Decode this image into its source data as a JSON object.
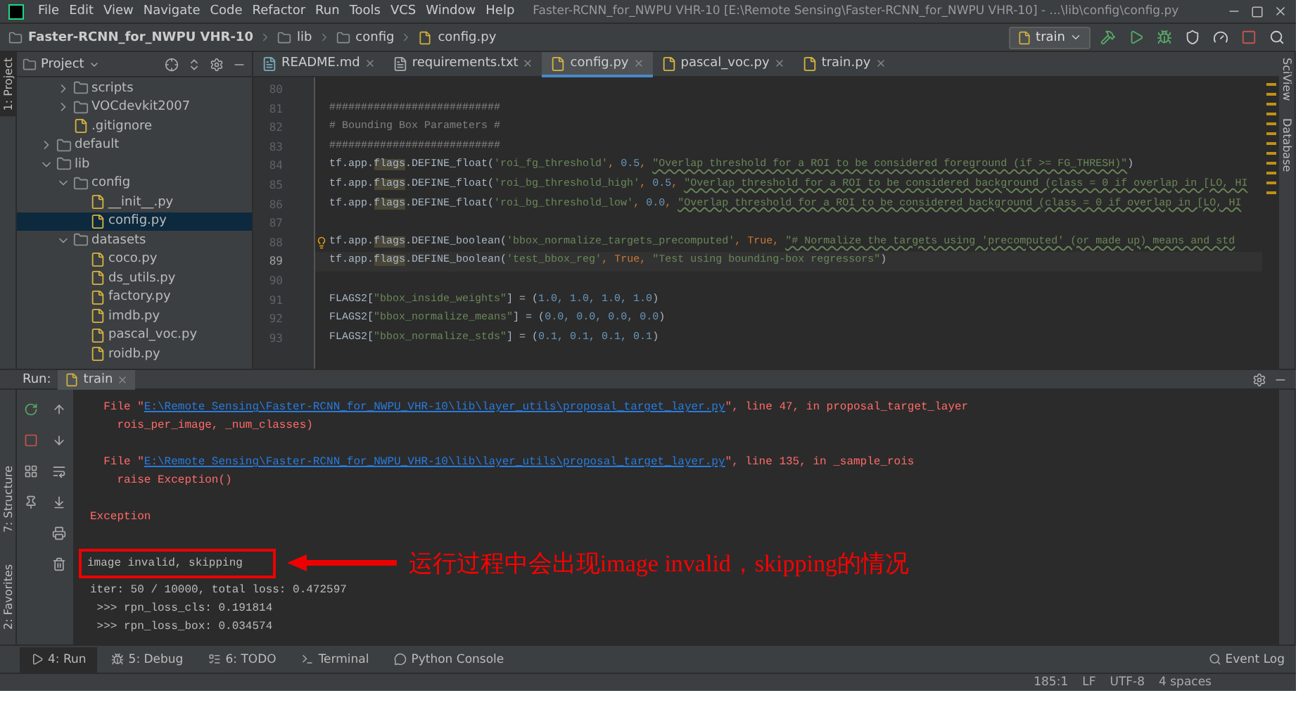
{
  "window": {
    "title": "Faster-RCNN_for_NWPU VHR-10 [E:\\Remote Sensing\\Faster-RCNN_for_NWPU VHR-10] - ...\\lib\\config\\config.py"
  },
  "menu": [
    "File",
    "Edit",
    "View",
    "Navigate",
    "Code",
    "Refactor",
    "Run",
    "Tools",
    "VCS",
    "Window",
    "Help"
  ],
  "breadcrumb": [
    {
      "kind": "project",
      "label": "Faster-RCNN_for_NWPU VHR-10"
    },
    {
      "kind": "folder",
      "label": "lib"
    },
    {
      "kind": "folder",
      "label": "config"
    },
    {
      "kind": "file",
      "label": "config.py"
    }
  ],
  "run_config": "train",
  "left_strip": [
    {
      "label": "1: Project",
      "selected": true
    },
    {
      "label": "7: Structure",
      "selected": false
    },
    {
      "label": "2: Favorites",
      "selected": false
    }
  ],
  "right_strip": [
    "SciView",
    "Database"
  ],
  "project_panel": {
    "title": "Project",
    "items_of_hidden_folder": [
      {
        "kind": "folder",
        "label": "scripts",
        "expanded": false,
        "selected": false
      },
      {
        "kind": "folder",
        "label": "VOCdevkit2007",
        "expanded": false,
        "selected": false
      },
      {
        "kind": "file",
        "label": ".gitignore",
        "selected": false
      }
    ],
    "tree": [
      {
        "kind": "folder",
        "label": "default",
        "expanded": false,
        "selected": false
      },
      {
        "kind": "folder",
        "label": "lib",
        "expanded": true,
        "selected": false,
        "children": [
          {
            "kind": "folder",
            "label": "config",
            "expanded": true,
            "selected": false,
            "children": [
              {
                "kind": "file",
                "label": "__init__.py",
                "selected": false
              },
              {
                "kind": "file",
                "label": "config.py",
                "selected": true
              }
            ]
          },
          {
            "kind": "folder",
            "label": "datasets",
            "expanded": true,
            "selected": false,
            "children": [
              {
                "kind": "file",
                "label": "coco.py",
                "selected": false
              },
              {
                "kind": "file",
                "label": "ds_utils.py",
                "selected": false
              },
              {
                "kind": "file",
                "label": "factory.py",
                "selected": false
              },
              {
                "kind": "file",
                "label": "imdb.py",
                "selected": false
              },
              {
                "kind": "file",
                "label": "pascal_voc.py",
                "selected": false
              },
              {
                "kind": "file",
                "label": "roidb.py",
                "selected": false
              }
            ]
          }
        ]
      }
    ]
  },
  "editor_tabs": [
    {
      "label": "README.md",
      "kind": "markdown",
      "selected": false
    },
    {
      "label": "requirements.txt",
      "kind": "text",
      "selected": false
    },
    {
      "label": "config.py",
      "kind": "python",
      "selected": true
    },
    {
      "label": "pascal_voc.py",
      "kind": "python",
      "selected": false
    },
    {
      "label": "train.py",
      "kind": "python",
      "selected": false
    }
  ],
  "code_lines": [
    {
      "number": "80",
      "current": false
    },
    {
      "number": "81",
      "current": false,
      "tokens": [
        {
          "kind": "comment",
          "text": "###########################"
        }
      ]
    },
    {
      "number": "82",
      "current": false,
      "tokens": [
        {
          "kind": "comment",
          "text": "# Bounding Box Parameters #"
        }
      ]
    },
    {
      "number": "83",
      "current": false,
      "tokens": [
        {
          "kind": "comment",
          "text": "###########################"
        }
      ]
    },
    {
      "number": "84",
      "current": false,
      "tokens": [
        {
          "kind": "plain",
          "text": "tf.app."
        },
        {
          "kind": "flag",
          "text": "flags"
        },
        {
          "kind": "plain",
          "text": ".DEFINE_float("
        },
        {
          "kind": "str",
          "text": "'roi_fg_threshold'"
        },
        {
          "kind": "kw",
          "text": ", "
        },
        {
          "kind": "num",
          "text": "0.5"
        },
        {
          "kind": "kw",
          "text": ", "
        },
        {
          "kind": "doc",
          "text": "\"Overlap threshold for a ROI to be considered foreground (if >= FG_THRESH)\""
        },
        {
          "kind": "plain",
          "text": ")"
        }
      ]
    },
    {
      "number": "85",
      "current": false,
      "tokens": [
        {
          "kind": "plain",
          "text": "tf.app."
        },
        {
          "kind": "flag",
          "text": "flags"
        },
        {
          "kind": "plain",
          "text": ".DEFINE_float("
        },
        {
          "kind": "str",
          "text": "'roi_bg_threshold_high'"
        },
        {
          "kind": "kw",
          "text": ", "
        },
        {
          "kind": "num",
          "text": "0.5"
        },
        {
          "kind": "kw",
          "text": ", "
        },
        {
          "kind": "doc",
          "text": "\"Overlap threshold for a ROI to be considered background (class = 0 if overlap in [LO, HI"
        }
      ]
    },
    {
      "number": "86",
      "current": false,
      "tokens": [
        {
          "kind": "plain",
          "text": "tf.app."
        },
        {
          "kind": "flag",
          "text": "flags"
        },
        {
          "kind": "plain",
          "text": ".DEFINE_float("
        },
        {
          "kind": "str",
          "text": "'roi_bg_threshold_low'"
        },
        {
          "kind": "kw",
          "text": ", "
        },
        {
          "kind": "num",
          "text": "0.0"
        },
        {
          "kind": "kw",
          "text": ", "
        },
        {
          "kind": "doc",
          "text": "\"Overlap threshold for a ROI to be considered background (class = 0 if overlap in [LO, HI"
        }
      ]
    },
    {
      "number": "87",
      "current": false
    },
    {
      "number": "88",
      "current": false,
      "bulb": true,
      "tokens": [
        {
          "kind": "plain",
          "text": "tf.app."
        },
        {
          "kind": "flag",
          "text": "flags"
        },
        {
          "kind": "plain",
          "text": ".DEFINE_boolean("
        },
        {
          "kind": "str",
          "text": "'bbox_normalize_targets_precomputed'"
        },
        {
          "kind": "kw",
          "text": ", True, "
        },
        {
          "kind": "doc",
          "text": "\"# Normalize the targets using 'precomputed' (or made up) means and std"
        }
      ]
    },
    {
      "number": "89",
      "current": true,
      "tokens": [
        {
          "kind": "plain",
          "text": "tf.app."
        },
        {
          "kind": "flag",
          "text": "flags"
        },
        {
          "kind": "plain",
          "text": ".DEFINE_boolean("
        },
        {
          "kind": "str",
          "text": "'test_bbox_reg'"
        },
        {
          "kind": "kw",
          "text": ", True, "
        },
        {
          "kind": "str",
          "text": "\"Test using bounding-box regressors\""
        },
        {
          "kind": "plain",
          "text": ")"
        }
      ]
    },
    {
      "number": "90",
      "current": false
    },
    {
      "number": "91",
      "current": false,
      "tokens": [
        {
          "kind": "plain",
          "text": "FLAGS2["
        },
        {
          "kind": "str",
          "text": "\"bbox_inside_weights\""
        },
        {
          "kind": "plain",
          "text": "] = ("
        },
        {
          "kind": "num",
          "text": "1.0, 1.0, 1.0, 1.0"
        },
        {
          "kind": "plain",
          "text": ")"
        }
      ]
    },
    {
      "number": "92",
      "current": false,
      "tokens": [
        {
          "kind": "plain",
          "text": "FLAGS2["
        },
        {
          "kind": "str",
          "text": "\"bbox_normalize_means\""
        },
        {
          "kind": "plain",
          "text": "] = ("
        },
        {
          "kind": "num",
          "text": "0.0, 0.0, 0.0, 0.0"
        },
        {
          "kind": "plain",
          "text": ")"
        }
      ]
    },
    {
      "number": "93",
      "current": false,
      "tokens": [
        {
          "kind": "plain",
          "text": "FLAGS2["
        },
        {
          "kind": "str",
          "text": "\"bbox_normalize_stds\""
        },
        {
          "kind": "plain",
          "text": "] = ("
        },
        {
          "kind": "num",
          "text": "0.1, 0.1, 0.1, 0.1"
        },
        {
          "kind": "plain",
          "text": ")"
        }
      ]
    }
  ],
  "run_panel": {
    "label": "Run:",
    "tab": "train",
    "lines": [
      {
        "kind": "error",
        "tokens": [
          {
            "kind": "err",
            "text": "  File \""
          },
          {
            "kind": "link",
            "text": "E:\\Remote Sensing\\Faster-RCNN_for_NWPU_VHR-10\\lib\\layer_utils\\proposal_target_layer.py"
          },
          {
            "kind": "err",
            "text": "\", line 47, in proposal_target_layer"
          }
        ]
      },
      {
        "kind": "error",
        "tokens": [
          {
            "kind": "err",
            "text": "    rois_per_image, _num_classes)"
          }
        ]
      },
      {
        "kind": "blank"
      },
      {
        "kind": "error",
        "tokens": [
          {
            "kind": "err",
            "text": "  File \""
          },
          {
            "kind": "link",
            "text": "E:\\Remote Sensing\\Faster-RCNN_for_NWPU_VHR-10\\lib\\layer_utils\\proposal_target_layer.py"
          },
          {
            "kind": "err",
            "text": "\", line 135, in _sample_rois"
          }
        ]
      },
      {
        "kind": "error",
        "tokens": [
          {
            "kind": "err",
            "text": "    raise Exception()"
          }
        ]
      },
      {
        "kind": "blank"
      },
      {
        "kind": "error",
        "tokens": [
          {
            "kind": "err",
            "text": "Exception"
          }
        ]
      },
      {
        "kind": "blank"
      },
      {
        "kind": "boxed",
        "tokens": [
          {
            "kind": "out",
            "text": "image invalid, skipping"
          }
        ],
        "note": "运行过程中会出现image invalid，skipping的情况"
      },
      {
        "kind": "output",
        "tokens": [
          {
            "kind": "out",
            "text": "iter: 50 / 10000, total loss: 0.472597"
          }
        ]
      },
      {
        "kind": "output",
        "tokens": [
          {
            "kind": "out",
            "text": " >>> rpn_loss_cls: 0.191814"
          }
        ]
      },
      {
        "kind": "output",
        "tokens": [
          {
            "kind": "out",
            "text": " >>> rpn_loss_box: 0.034574"
          }
        ]
      }
    ]
  },
  "tool_tabs": [
    {
      "label": "4: Run",
      "kind": "run",
      "selected": true
    },
    {
      "label": "5: Debug",
      "kind": "debug",
      "selected": false
    },
    {
      "label": "6: TODO",
      "kind": "todo",
      "selected": false
    },
    {
      "label": "Terminal",
      "kind": "terminal",
      "selected": false
    },
    {
      "label": "Python Console",
      "kind": "python",
      "selected": false
    }
  ],
  "event_log": "Event Log",
  "status_bar": [
    "185:1",
    "LF",
    "UTF-8",
    "4 spaces"
  ]
}
